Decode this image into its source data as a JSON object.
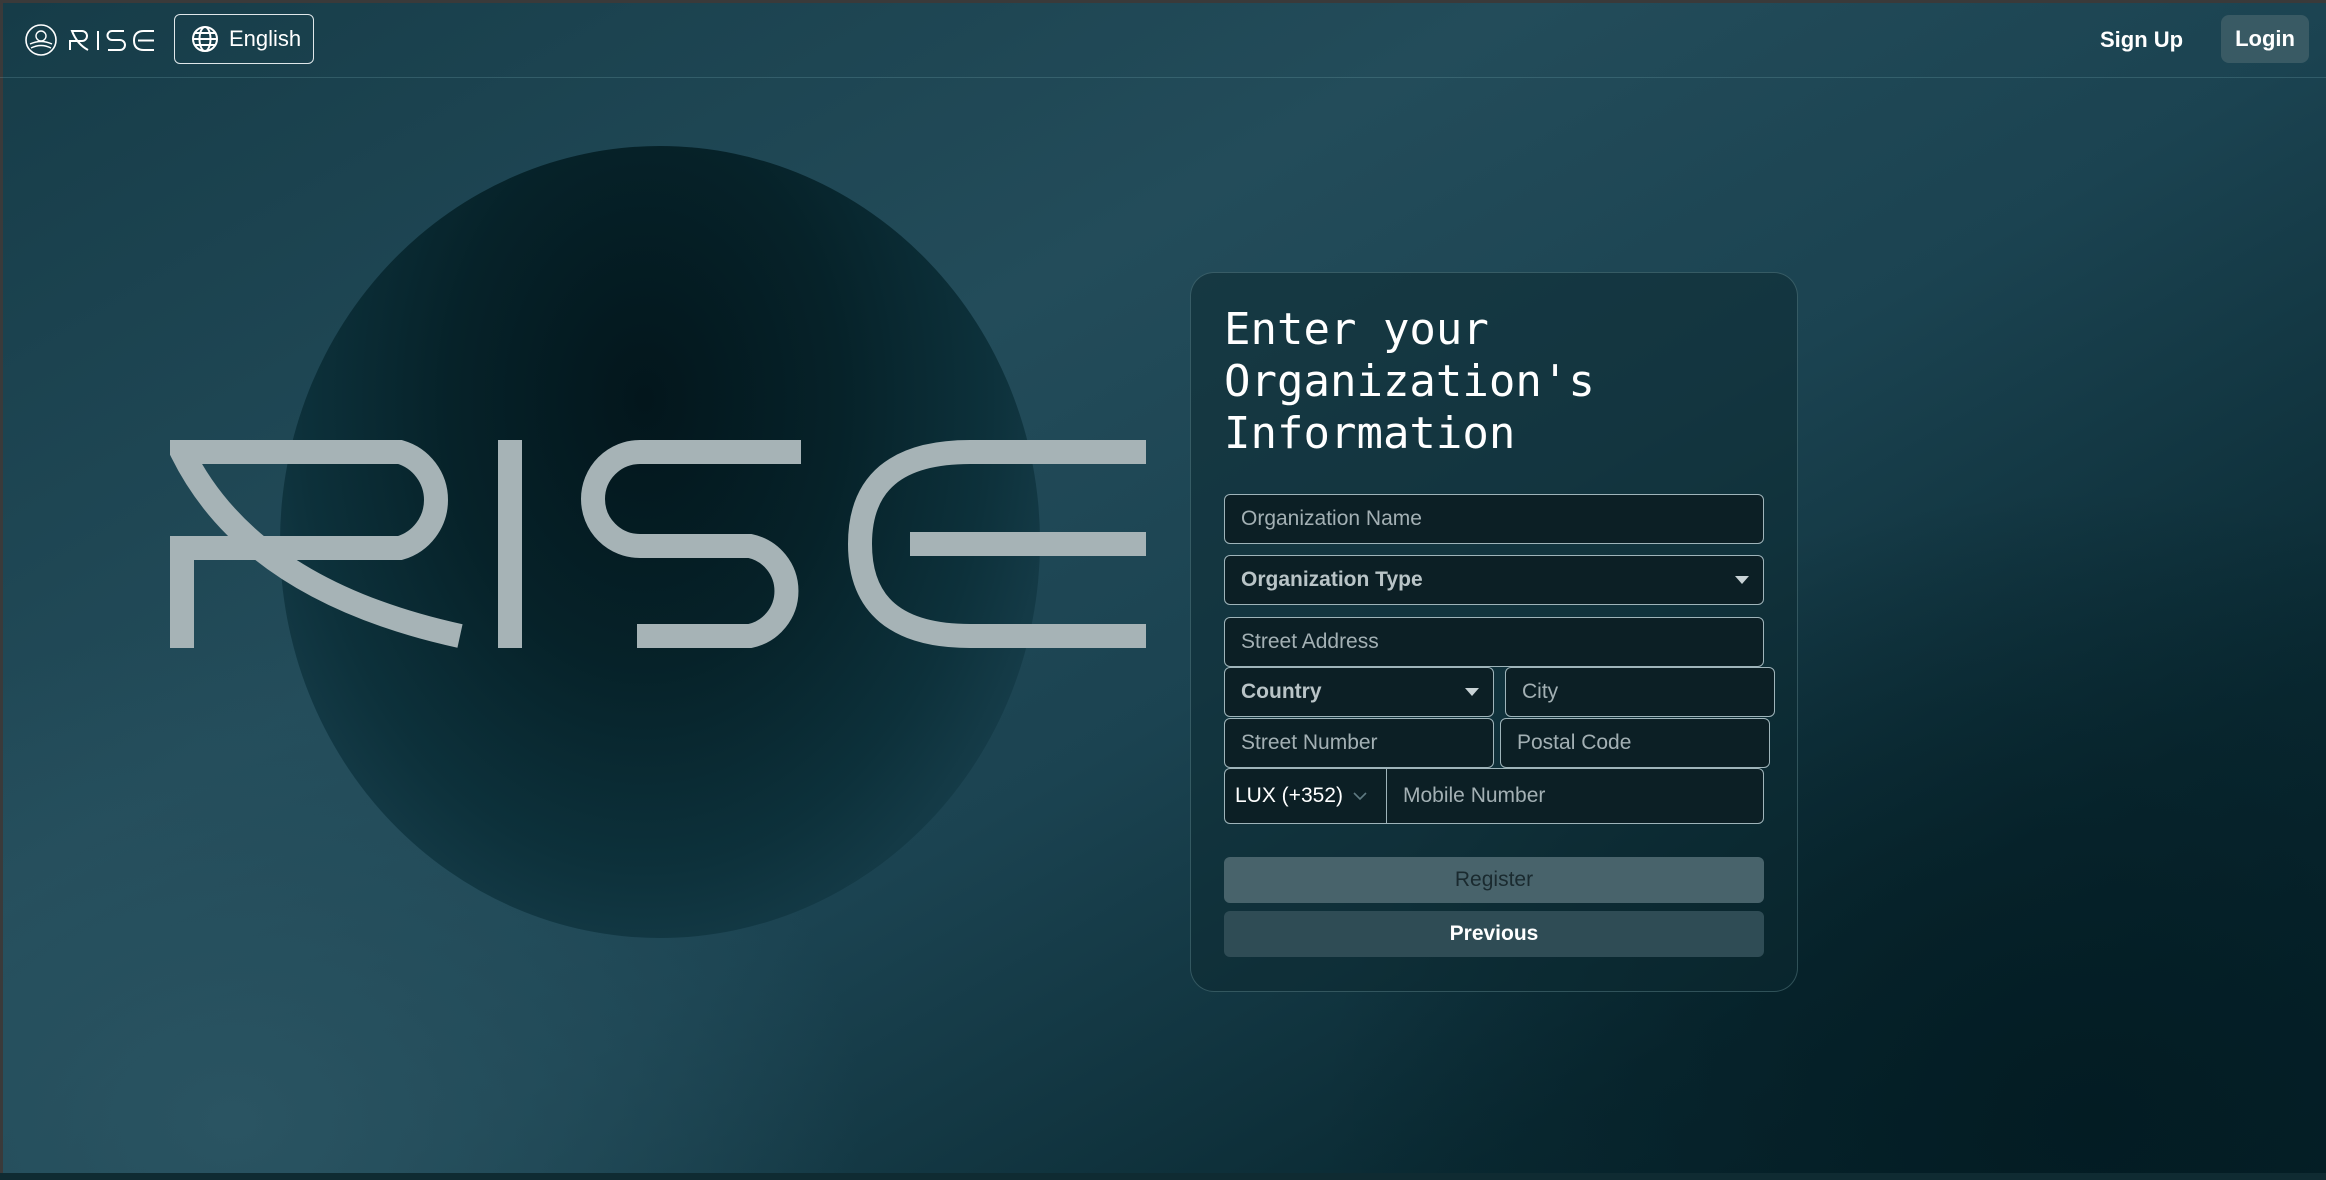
{
  "header": {
    "logo_text": "RISE",
    "language_label": "English",
    "signup_label": "Sign Up",
    "login_label": "Login"
  },
  "hero": {
    "brand_text": "RISE"
  },
  "form": {
    "title": "Enter your Organization's Information",
    "organization_name_placeholder": "Organization Name",
    "organization_type_label": "Organization Type",
    "street_address_placeholder": "Street Address",
    "country_label": "Country",
    "city_placeholder": "City",
    "street_number_placeholder": "Street Number",
    "postal_code_placeholder": "Postal Code",
    "country_code_label": "LUX (+352)",
    "mobile_number_placeholder": "Mobile Number",
    "register_label": "Register",
    "previous_label": "Previous"
  },
  "icons": {
    "logo": "rise-logo-icon",
    "language": "globe-icon",
    "select_caret": "caret-down-icon",
    "country_code_chevron": "chevron-down-icon"
  },
  "colors": {
    "background_dark": "#05212a",
    "background_teal": "#234c5a",
    "register_button": "#48636b",
    "previous_button": "#2f4c55",
    "login_button": "#395a64"
  }
}
